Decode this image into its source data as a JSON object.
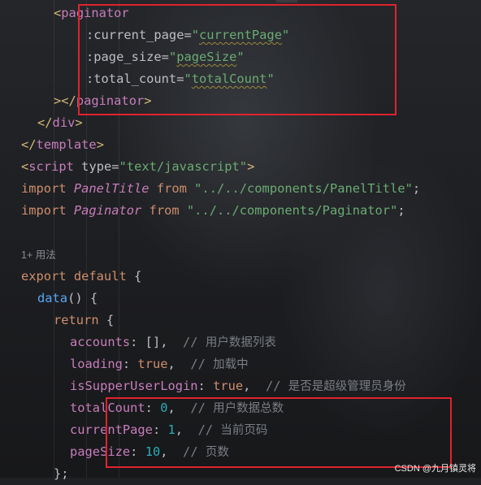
{
  "editor": {
    "lines": [
      {
        "indent": "    ",
        "tokens": [
          [
            "tag",
            "<"
          ],
          [
            "tagname",
            "paginator"
          ]
        ]
      },
      {
        "indent": "        ",
        "tokens": [
          [
            "attr",
            ":current_page"
          ],
          [
            "plain",
            "="
          ],
          [
            "str",
            "\""
          ],
          [
            "str-wavy",
            "currentPage"
          ],
          [
            "str",
            "\""
          ]
        ]
      },
      {
        "indent": "        ",
        "tokens": [
          [
            "attr",
            ":page_size"
          ],
          [
            "plain",
            "="
          ],
          [
            "str",
            "\""
          ],
          [
            "str-wavy",
            "pageSize"
          ],
          [
            "str",
            "\""
          ]
        ]
      },
      {
        "indent": "        ",
        "tokens": [
          [
            "attr",
            ":total_count"
          ],
          [
            "plain",
            "="
          ],
          [
            "str",
            "\""
          ],
          [
            "str-wavy",
            "totalCount"
          ],
          [
            "str",
            "\""
          ]
        ]
      },
      {
        "indent": "    ",
        "tokens": [
          [
            "tag",
            ">"
          ],
          [
            "tag",
            "</"
          ],
          [
            "tagname",
            "paginator"
          ],
          [
            "tag",
            ">"
          ]
        ]
      },
      {
        "indent": "  ",
        "tokens": [
          [
            "tag",
            "</"
          ],
          [
            "tagname",
            "div"
          ],
          [
            "tag",
            ">"
          ]
        ]
      },
      {
        "indent": "",
        "tokens": [
          [
            "tag",
            "</"
          ],
          [
            "tagname",
            "template"
          ],
          [
            "tag",
            ">"
          ]
        ]
      },
      {
        "indent": "",
        "tokens": [
          [
            "tag",
            "<"
          ],
          [
            "tagname",
            "script"
          ],
          [
            "plain",
            " "
          ],
          [
            "attr",
            "type"
          ],
          [
            "plain",
            "="
          ],
          [
            "str",
            "\"text/javascript\""
          ],
          [
            "tag",
            ">"
          ]
        ]
      },
      {
        "indent": "",
        "tokens": [
          [
            "kw",
            "import "
          ],
          [
            "cls",
            "PanelTitle"
          ],
          [
            "kw",
            " from "
          ],
          [
            "str",
            "\"../../components/PanelTitle\""
          ],
          [
            "plain",
            ";"
          ]
        ]
      },
      {
        "indent": "",
        "tokens": [
          [
            "kw",
            "import "
          ],
          [
            "cls",
            "Paginator"
          ],
          [
            "kw",
            " from "
          ],
          [
            "str",
            "\"../../components/Paginator\""
          ],
          [
            "plain",
            ";"
          ]
        ]
      },
      {
        "indent": "",
        "tokens": []
      },
      {
        "indent": "",
        "small": true,
        "tokens": [
          [
            "small",
            "1+ 用法"
          ]
        ]
      },
      {
        "indent": "",
        "tokens": [
          [
            "kw",
            "export default "
          ],
          [
            "plain",
            "{"
          ]
        ]
      },
      {
        "indent": "  ",
        "tokens": [
          [
            "fn",
            "data"
          ],
          [
            "plain",
            "() {"
          ]
        ]
      },
      {
        "indent": "    ",
        "tokens": [
          [
            "kw",
            "return "
          ],
          [
            "plain",
            "{"
          ]
        ]
      },
      {
        "indent": "      ",
        "tokens": [
          [
            "prop",
            "accounts"
          ],
          [
            "plain",
            ": [],  "
          ],
          [
            "cmt",
            "// "
          ],
          [
            "cmt-text",
            "用户数据列表"
          ]
        ]
      },
      {
        "indent": "      ",
        "tokens": [
          [
            "prop",
            "loading"
          ],
          [
            "plain",
            ": "
          ],
          [
            "kw",
            "true"
          ],
          [
            "plain",
            ",  "
          ],
          [
            "cmt",
            "// "
          ],
          [
            "cmt-text",
            "加载中"
          ]
        ]
      },
      {
        "indent": "      ",
        "tokens": [
          [
            "prop",
            "isSupperUserLogin"
          ],
          [
            "plain",
            ": "
          ],
          [
            "kw",
            "true"
          ],
          [
            "plain",
            ",  "
          ],
          [
            "cmt",
            "// "
          ],
          [
            "cmt-text",
            "是否是超级管理员身份"
          ]
        ]
      },
      {
        "indent": "      ",
        "tokens": [
          [
            "prop",
            "totalCount"
          ],
          [
            "plain",
            ": "
          ],
          [
            "num",
            "0"
          ],
          [
            "plain",
            ",  "
          ],
          [
            "cmt",
            "// "
          ],
          [
            "cmt-text",
            "用户数据总数"
          ]
        ]
      },
      {
        "indent": "      ",
        "tokens": [
          [
            "prop",
            "currentPage"
          ],
          [
            "plain",
            ": "
          ],
          [
            "num",
            "1"
          ],
          [
            "plain",
            ",  "
          ],
          [
            "cmt",
            "// "
          ],
          [
            "cmt-text",
            "当前页码"
          ]
        ]
      },
      {
        "indent": "      ",
        "tokens": [
          [
            "prop",
            "pageSize"
          ],
          [
            "plain",
            ": "
          ],
          [
            "num",
            "10"
          ],
          [
            "plain",
            ",  "
          ],
          [
            "cmt",
            "// "
          ],
          [
            "cmt-text",
            "页数"
          ]
        ]
      },
      {
        "indent": "    ",
        "tokens": [
          [
            "plain",
            "};"
          ]
        ]
      }
    ]
  },
  "highlight_color": "#e0232e",
  "watermark": "CSDN @九月镇灵将"
}
